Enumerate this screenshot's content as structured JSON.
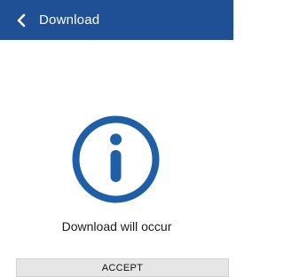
{
  "app_bar": {
    "title": "Download",
    "back_icon": "chevron-left-icon",
    "background_color": "#1f4f95"
  },
  "dialog": {
    "icon": "info-icon",
    "icon_color": "#1f5fa8",
    "message": "Download will occur",
    "accept_label": "ACCEPT"
  }
}
